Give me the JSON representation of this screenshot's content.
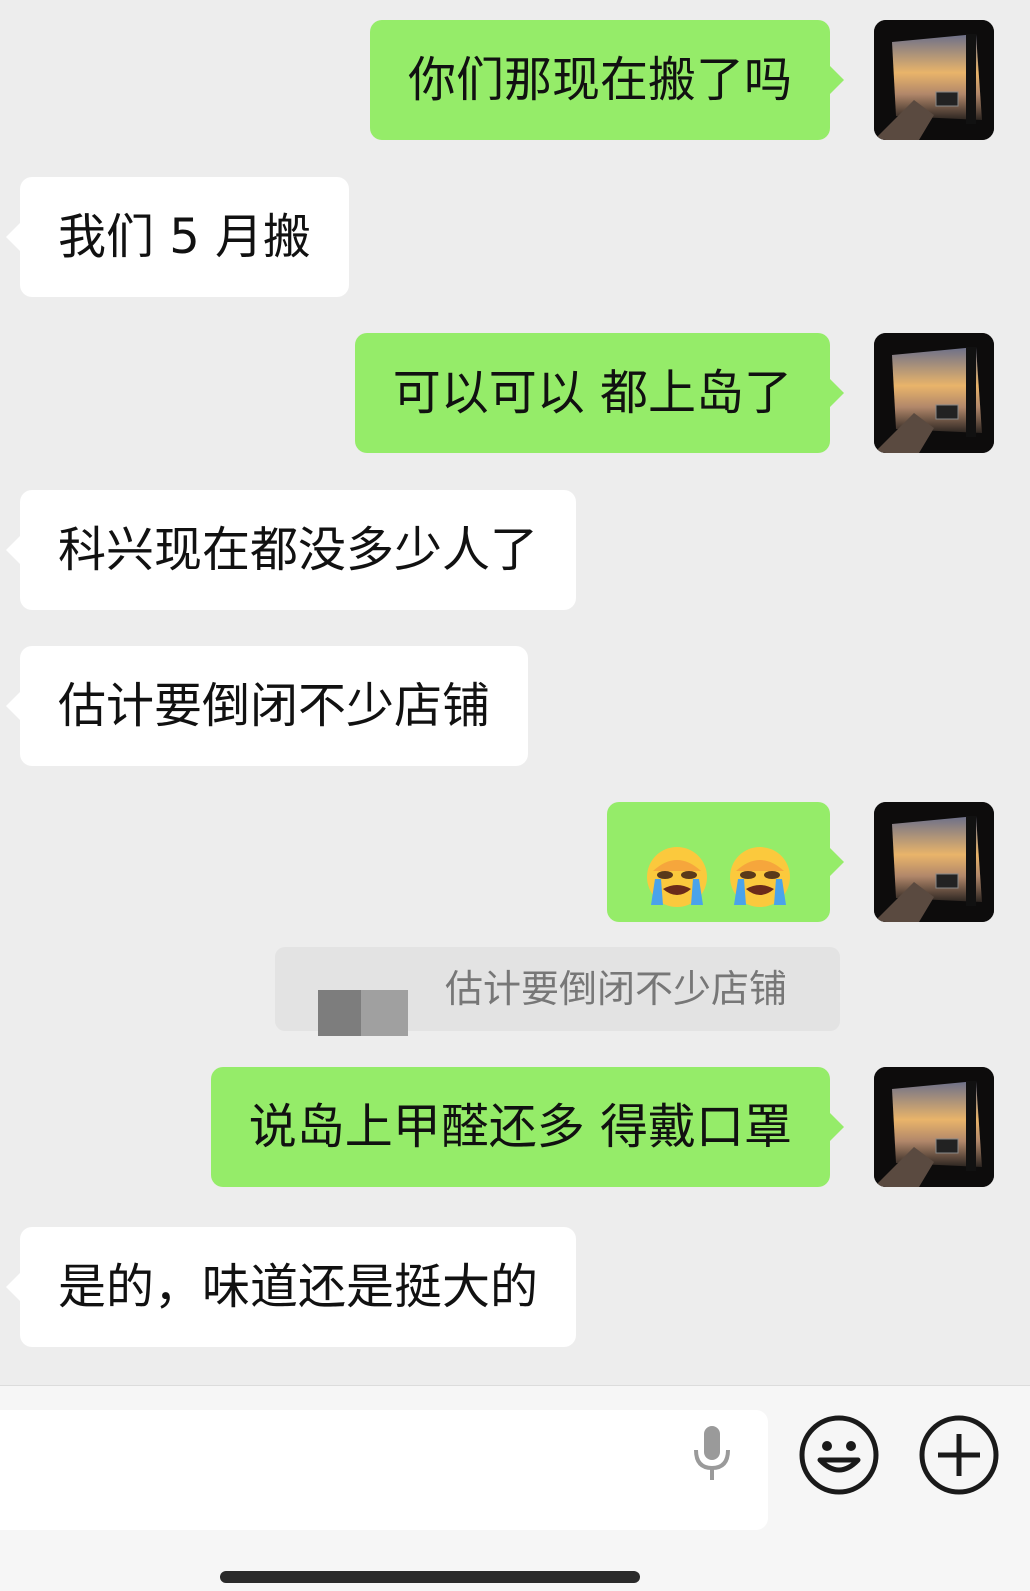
{
  "messages": [
    {
      "side": "out",
      "text": "你们那现在搬了吗"
    },
    {
      "side": "in",
      "text": "我们 5 月搬"
    },
    {
      "side": "out",
      "text": "可以可以 都上岛了"
    },
    {
      "side": "in",
      "text": "科兴现在都没多少人了"
    },
    {
      "side": "in",
      "text": "估计要倒闭不少店铺"
    },
    {
      "side": "out",
      "emoji": [
        "loudly-crying-face",
        "loudly-crying-face"
      ]
    },
    {
      "side": "out",
      "text": "说岛上甲醛还多 得戴口罩"
    },
    {
      "side": "in",
      "text": "是的，味道还是挺大的"
    }
  ],
  "quote": {
    "text": "估计要倒闭不少店铺"
  },
  "input_bar": {
    "value": "",
    "icons": [
      "microphone-icon",
      "emoji-icon",
      "plus-icon"
    ]
  },
  "colors": {
    "out_bubble": "#95ec69",
    "in_bubble": "#ffffff",
    "background": "#ededed"
  }
}
